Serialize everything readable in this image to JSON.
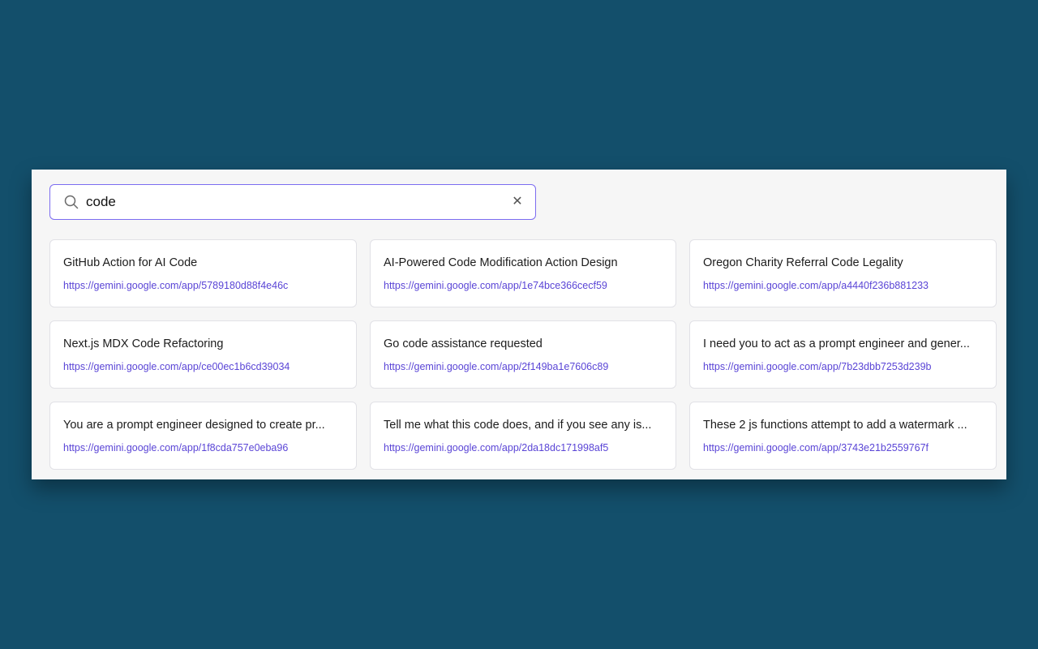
{
  "search": {
    "value": "code",
    "icon": "search-icon",
    "clear_icon": "close-icon",
    "clear_glyph": "✕"
  },
  "colors": {
    "background": "#134f6b",
    "panel": "#f6f6f6",
    "accent": "#7c6cf0",
    "link": "#5a45d6"
  },
  "results": [
    {
      "title": "GitHub Action for AI Code",
      "url": "https://gemini.google.com/app/5789180d88f4e46c"
    },
    {
      "title": "AI-Powered Code Modification Action Design",
      "url": "https://gemini.google.com/app/1e74bce366cecf59"
    },
    {
      "title": "Oregon Charity Referral Code Legality",
      "url": "https://gemini.google.com/app/a4440f236b881233"
    },
    {
      "title": "Next.js MDX Code Refactoring",
      "url": "https://gemini.google.com/app/ce00ec1b6cd39034"
    },
    {
      "title": "Go code assistance requested",
      "url": "https://gemini.google.com/app/2f149ba1e7606c89"
    },
    {
      "title": "I need you to act as a prompt engineer and gener...",
      "url": "https://gemini.google.com/app/7b23dbb7253d239b"
    },
    {
      "title": "You are a prompt engineer designed to create pr...",
      "url": "https://gemini.google.com/app/1f8cda757e0eba96"
    },
    {
      "title": "Tell me what this code does, and if you see any is...",
      "url": "https://gemini.google.com/app/2da18dc171998af5"
    },
    {
      "title": "These 2 js functions attempt to add a watermark ...",
      "url": "https://gemini.google.com/app/3743e21b2559767f"
    }
  ]
}
